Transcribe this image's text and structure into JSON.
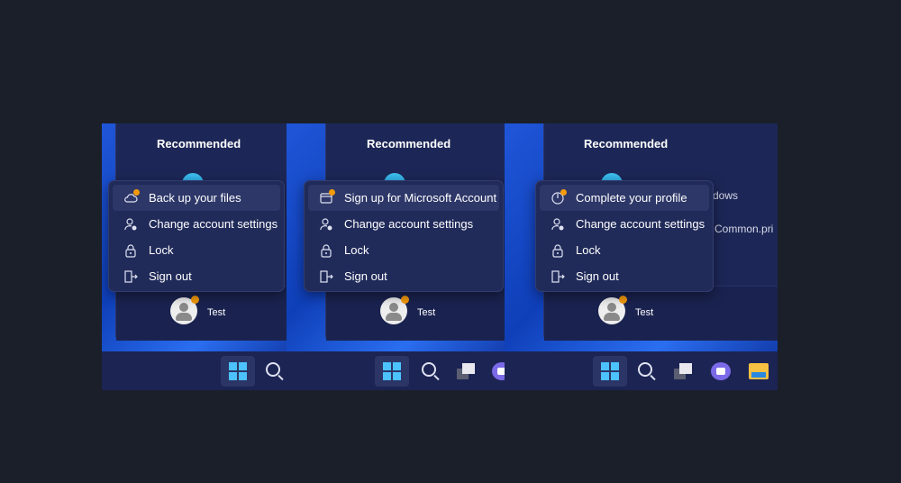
{
  "accent_color": "#4cc2ff",
  "notification_color": "#f59b0c",
  "screenshots": [
    {
      "recommended": "Recommended",
      "ghost_texts": [],
      "user": "Test",
      "menu": [
        {
          "label": "Back up your files",
          "icon": "cloud-icon"
        },
        {
          "label": "Change account settings",
          "icon": "user-gear-icon"
        },
        {
          "label": "Lock",
          "icon": "lock-icon"
        },
        {
          "label": "Sign out",
          "icon": "sign-out-icon"
        }
      ]
    },
    {
      "recommended": "Recommended",
      "ghost_texts": [],
      "user": "Test",
      "menu": [
        {
          "label": "Sign up for Microsoft Account",
          "icon": "window-icon"
        },
        {
          "label": "Change account settings",
          "icon": "user-gear-icon"
        },
        {
          "label": "Lock",
          "icon": "lock-icon"
        },
        {
          "label": "Sign out",
          "icon": "sign-out-icon"
        }
      ]
    },
    {
      "recommended": "Recommended",
      "ghost_texts": [
        "dows",
        "Common.pri"
      ],
      "user": "Test",
      "menu": [
        {
          "label": "Complete your profile",
          "icon": "progress-icon"
        },
        {
          "label": "Change account settings",
          "icon": "user-gear-icon"
        },
        {
          "label": "Lock",
          "icon": "lock-icon"
        },
        {
          "label": "Sign out",
          "icon": "sign-out-icon"
        }
      ]
    }
  ]
}
